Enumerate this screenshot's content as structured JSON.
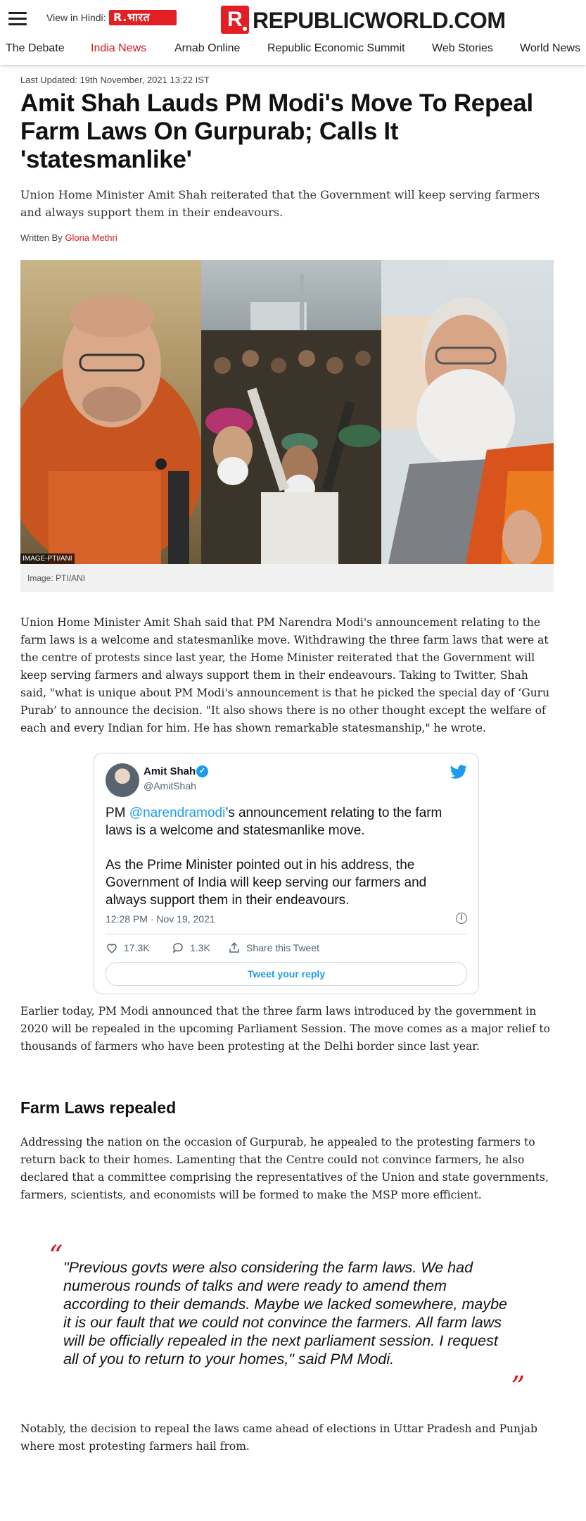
{
  "header": {
    "hindi_label": "View in Hindi:",
    "hindi_logo_text": "R.भारत",
    "brand_mark": "R",
    "brand_name": "REPUBLICWORLD.COM",
    "accent_color": "#d71920"
  },
  "nav": {
    "items": [
      "The Debate",
      "India News",
      "Arnab Online",
      "Republic Economic Summit",
      "Web Stories",
      "World News"
    ],
    "active": "India News"
  },
  "article": {
    "last_updated": "Last Updated: 19th November, 2021 13:22 IST",
    "headline": "Amit Shah Lauds PM Modi's Move To Repeal Farm Laws On Gurpurab; Calls It 'statesmanlike'",
    "standfirst": "Union Home Minister Amit Shah reiterated that the Government will keep serving farmers and always support them in their endeavours.",
    "byline_prefix": "Written By",
    "author": "Gloria Methri",
    "image_tag": "IMAGE-PTI/ANI",
    "image_caption": "Image: PTI/ANI",
    "para1": "Union Home Minister Amit Shah said that PM Narendra Modi's announcement relating to the farm laws is a welcome and statesmanlike move. Withdrawing the three farm laws that were at the centre of protests since last year, the Home Minister reiterated that the Government will keep serving farmers and always support them in their endeavours. Taking to Twitter, Shah said, \"what is unique about PM Modi's announcement is that he picked the special day of ‘Guru Purab’ to announce the decision. \"It also shows there is no other thought except the welfare of each and every Indian for him. He has shown remarkable statesmanship,\" he wrote.",
    "para2": "Earlier today, PM Modi announced that the three farm laws introduced by the government in 2020 will be repealed in the upcoming Parliament Session. The move comes as a major relief to thousands of farmers who have been protesting at the Delhi border since last year.",
    "subhead": "Farm Laws repealed",
    "para3": "Addressing the nation on the occasion of Gurpurab, he appealed to the protesting farmers to return back to their homes. Lamenting that the Centre could not convince farmers, he also declared that a committee comprising the representatives of the Union and state governments, farmers, scientists, and economists will be formed to make the MSP more efficient.",
    "quote": "\"Previous govts were also considering the farm laws. We had numerous rounds of talks and were ready to amend them according to their demands. Maybe we lacked somewhere, maybe it is our fault that we could not convince the farmers. All farm laws will be officially repealed in the next parliament session. I request all of you to return to your homes,\" said PM Modi.",
    "quote_open": "“",
    "quote_close": "”",
    "para4": "Notably, the decision to repeal the laws came ahead of elections in Uttar Pradesh and Punjab where most protesting farmers hail from."
  },
  "tweet": {
    "name": "Amit Shah",
    "verified_mark": "✓",
    "handle": "@AmitShah",
    "text_prefix": "PM ",
    "mention": "@narendramodi",
    "text_rest": "’s announcement relating to the farm laws is a welcome and statesmanlike move.",
    "text2": "As the Prime Minister pointed out in his address, the Government of India will keep serving our farmers and always support them in their endeavours.",
    "time": "12:28 PM · Nov 19, 2021",
    "info_symbol": "i",
    "likes": "17.3K",
    "replies": "1.3K",
    "share_label": "Share this Tweet",
    "reply_button": "Tweet your reply",
    "brand_color": "#1d9bf0"
  }
}
